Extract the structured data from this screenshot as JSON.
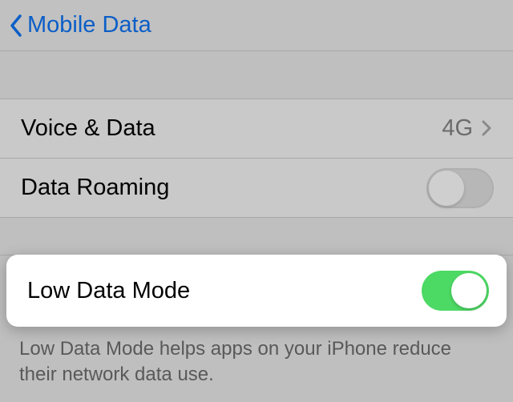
{
  "nav": {
    "back_label": "Mobile Data"
  },
  "rows": {
    "voice_data": {
      "label": "Voice & Data",
      "value": "4G"
    },
    "data_roaming": {
      "label": "Data Roaming",
      "on": false
    },
    "low_data_mode": {
      "label": "Low Data Mode",
      "on": true
    }
  },
  "footer": "Low Data Mode helps apps on your iPhone reduce their network data use.",
  "colors": {
    "accent_blue": "#0b5ec7",
    "toggle_green": "#4cd964"
  }
}
